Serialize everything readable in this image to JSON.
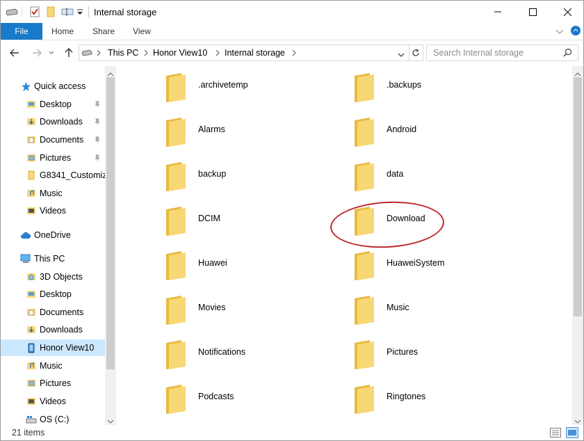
{
  "window": {
    "title": "Internal storage"
  },
  "ribbon": {
    "tabs": [
      "File",
      "Home",
      "Share",
      "View"
    ]
  },
  "address": {
    "crumbs": [
      "This PC",
      "Honor View10",
      "Internal storage"
    ],
    "search_placeholder": "Search Internal storage"
  },
  "nav": {
    "quick_access": "Quick access",
    "quick_items": [
      "Desktop",
      "Downloads",
      "Documents",
      "Pictures",
      "G8341_Customiz",
      "Music",
      "Videos"
    ],
    "onedrive": "OneDrive",
    "this_pc": "This PC",
    "pc_items": [
      "3D Objects",
      "Desktop",
      "Documents",
      "Downloads",
      "Honor View10",
      "Music",
      "Pictures",
      "Videos",
      "OS (C:)"
    ]
  },
  "folders": [
    ".archivetemp",
    ".backups",
    "Alarms",
    "Android",
    "backup",
    "data",
    "DCIM",
    "Download",
    "Huawei",
    "HuaweiSystem",
    "Movies",
    "Music",
    "Notifications",
    "Pictures",
    "Podcasts",
    "Ringtones"
  ],
  "status": {
    "count": "21 items"
  },
  "colors": {
    "accent": "#1979ca",
    "selected": "#cce8ff",
    "folder": "#f8d775",
    "annotation": "#c0282d"
  }
}
